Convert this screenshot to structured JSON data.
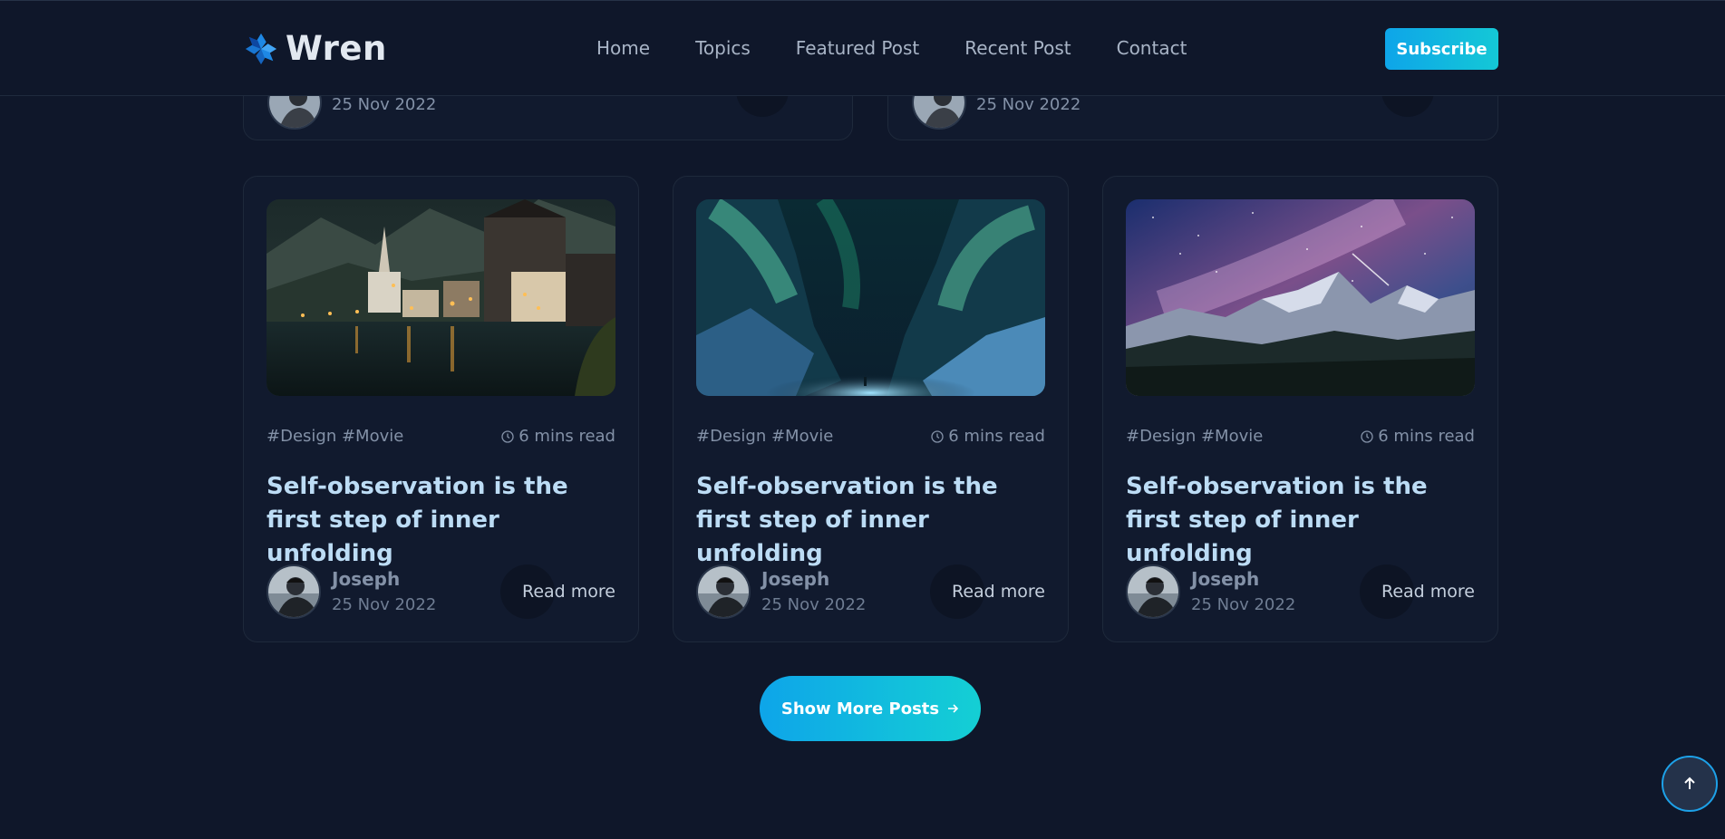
{
  "brand": {
    "name": "Wren",
    "icon": "snowflake-logo-icon"
  },
  "nav": {
    "items": [
      {
        "label": "Home"
      },
      {
        "label": "Topics"
      },
      {
        "label": "Featured Post"
      },
      {
        "label": "Recent Post"
      },
      {
        "label": "Contact"
      }
    ],
    "subscribe_label": "Subscribe"
  },
  "top_partial_cards": [
    {
      "date": "25 Nov 2022"
    },
    {
      "date": "25 Nov 2022"
    }
  ],
  "posts": [
    {
      "image": "lakeside-village-night",
      "tags": "#Design #Movie",
      "read_time": "6 mins read",
      "title": "Self-observation is the first step of inner unfolding",
      "author": "Joseph",
      "date": "25 Nov 2022",
      "cta": "Read more"
    },
    {
      "image": "aurora-canyon",
      "tags": "#Design #Movie",
      "read_time": "6 mins read",
      "title": "Self-observation is the first step of inner unfolding",
      "author": "Joseph",
      "date": "25 Nov 2022",
      "cta": "Read more"
    },
    {
      "image": "milky-way-mountains",
      "tags": "#Design #Movie",
      "read_time": "6 mins read",
      "title": "Self-observation is the first step of inner unfolding",
      "author": "Joseph",
      "date": "25 Nov 2022",
      "cta": "Read more"
    }
  ],
  "show_more_label": "Show More Posts",
  "back_to_top_icon": "arrow-up-icon",
  "colors": {
    "background": "#0f172a",
    "card": "#111a2e",
    "accent_start": "#0ea5e9",
    "accent_end": "#14cfd4",
    "title": "#bcdcf5"
  }
}
